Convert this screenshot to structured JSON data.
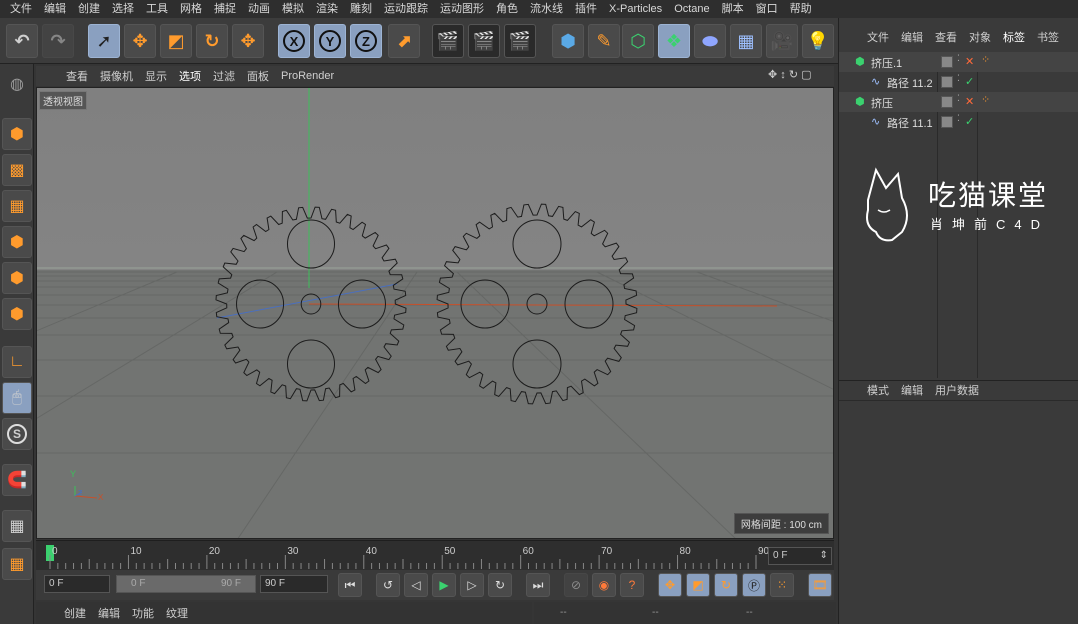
{
  "menubar": {
    "items": [
      "文件",
      "编辑",
      "创建",
      "选择",
      "工具",
      "网格",
      "捕捉",
      "动画",
      "模拟",
      "渲染",
      "雕刻",
      "运动跟踪",
      "运动图形",
      "角色",
      "流水线",
      "插件",
      "X-Particles",
      "Octane",
      "脚本",
      "窗口",
      "帮助"
    ]
  },
  "toolbar": {
    "axis_x": "X",
    "axis_y": "Y",
    "axis_z": "Z"
  },
  "viewport": {
    "menu": [
      "查看",
      "摄像机",
      "显示",
      "选项",
      "过滤",
      "面板",
      "ProRender"
    ],
    "active_menu": "选项",
    "label": "透视视图",
    "grid_spacing": "网格间距 : 100 cm",
    "axis_y_label": "Y",
    "axis_z_label": "Z",
    "axis_x_label": "X"
  },
  "timeline": {
    "ticks": [
      "0",
      "10",
      "20",
      "30",
      "40",
      "50",
      "60",
      "70",
      "80",
      "90"
    ],
    "current_frame_field": "0 F"
  },
  "transport": {
    "start_field": "0 F",
    "range_start": "0 F",
    "range_end": "90 F",
    "end_field": "90 F"
  },
  "bottom_menu": {
    "items": [
      "创建",
      "编辑",
      "功能",
      "纹理"
    ]
  },
  "coord_bar": {
    "labels": [
      "--",
      "--",
      "--"
    ]
  },
  "object_manager": {
    "menu": [
      "文件",
      "编辑",
      "查看",
      "对象",
      "标签",
      "书签"
    ],
    "active_menu": "标签",
    "objects": [
      {
        "name": "挤压.1",
        "level": 0
      },
      {
        "name": "路径 11.2",
        "level": 1
      },
      {
        "name": "挤压",
        "level": 0
      },
      {
        "name": "路径 11.1",
        "level": 1
      }
    ]
  },
  "attribute_manager": {
    "menu": [
      "模式",
      "编辑",
      "用户数据"
    ]
  },
  "watermark": {
    "title": "吃猫课堂",
    "subtitle": "肖坤前C4D"
  },
  "colors": {
    "accent": "#8aa0c0",
    "play_green": "#3bd16f",
    "timeline_marker": "#3bd16f"
  }
}
